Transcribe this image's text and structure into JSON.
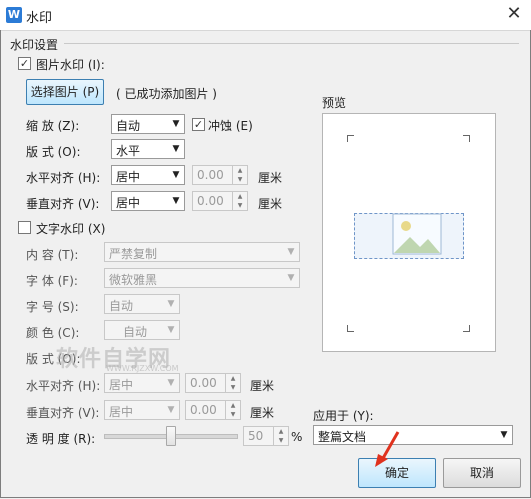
{
  "window": {
    "title": "水印",
    "app_icon_letter": "W"
  },
  "section_title": "水印设置",
  "image_wm": {
    "checkbox_label": "图片水印 (I):",
    "checked": true,
    "select_button": "选择图片 (P)",
    "status": "( 已成功添加图片 )",
    "scale_label": "缩    放 (Z):",
    "scale_value": "自动",
    "washout_label": "冲蚀 (E)",
    "washout_checked": true,
    "layout_label": "版    式 (O):",
    "layout_value": "水平",
    "halign_label": "水平对齐 (H):",
    "halign_value": "居中",
    "halign_offset": "0.00",
    "halign_unit": "厘米",
    "valign_label": "垂直对齐 (V):",
    "valign_value": "居中",
    "valign_offset": "0.00",
    "valign_unit": "厘米"
  },
  "text_wm": {
    "checkbox_label": "文字水印 (X)",
    "checked": false,
    "content_label": "内    容 (T):",
    "content_value": "严禁复制",
    "font_label": "字    体 (F):",
    "font_value": "微软雅黑",
    "size_label": "字    号 (S):",
    "size_value": "自动",
    "color_label": "颜    色 (C):",
    "color_value": "自动",
    "layout_label": "版    式 (O):",
    "halign_label": "水平对齐 (H):",
    "halign_value": "居中",
    "halign_offset": "0.00",
    "halign_unit": "厘米",
    "valign_label": "垂直对齐 (V):",
    "valign_value": "居中",
    "valign_offset": "0.00",
    "valign_unit": "厘米",
    "transparency_label": "透 明 度 (R):",
    "transparency_value": "50",
    "transparency_unit": "%"
  },
  "preview": {
    "label": "预览"
  },
  "apply": {
    "label": "应用于 (Y):",
    "value": "整篇文档"
  },
  "buttons": {
    "ok": "确定",
    "cancel": "取消"
  },
  "watermark_overlay": {
    "text": "软件自学网",
    "subtext": "WWW.RJZXW.COM"
  },
  "colors": {
    "accent": "#2b7bd6",
    "focus_border": "#3c7fb1",
    "arrow": "#e0321e"
  }
}
